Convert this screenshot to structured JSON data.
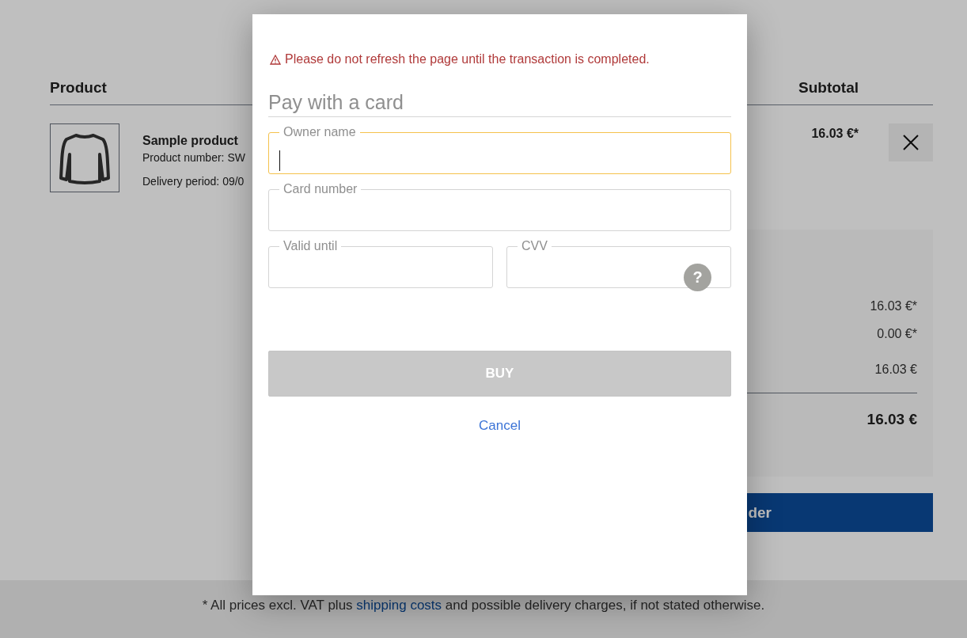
{
  "cart": {
    "columns": [
      "Product",
      "Subtotal"
    ],
    "items": [
      {
        "name": "Sample product",
        "product_number": "Product number: SW",
        "delivery": "Delivery period: 09/0",
        "subtotal": "16.03 €*"
      }
    ],
    "summary": {
      "values": [
        "16.03 €*",
        "0.00 €*",
        "16.03 €"
      ],
      "total": "16.03 €"
    },
    "checkout_button": "der"
  },
  "footer": {
    "before": "* All prices excl. VAT plus ",
    "link": "shipping costs",
    "after": " and possible delivery charges, if not stated otherwise."
  },
  "modal": {
    "warning": "Please do not refresh the page until the transaction is completed.",
    "title": "Pay with a card",
    "field_rows": [
      [
        {
          "label": "Owner name",
          "kind": "text",
          "focused": true
        }
      ],
      [
        {
          "label": "Card number",
          "kind": "text",
          "focused": false
        }
      ],
      [
        {
          "label": "Valid until",
          "kind": "text",
          "focused": false
        },
        {
          "label": "CVV",
          "kind": "cvv",
          "focused": false,
          "help": "?"
        }
      ]
    ],
    "buy_button": {
      "label": "BUY",
      "disabled": true
    },
    "cancel_link": "Cancel"
  }
}
